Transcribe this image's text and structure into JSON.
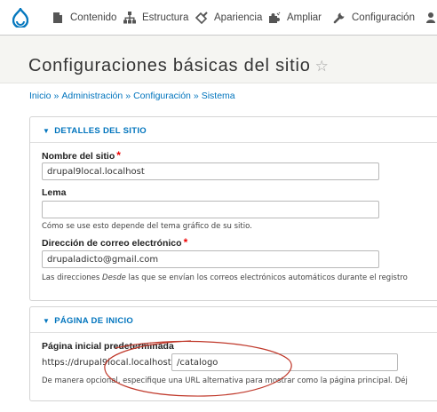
{
  "toolbar": {
    "items": [
      {
        "label": "Contenido",
        "icon": "page-icon"
      },
      {
        "label": "Estructura",
        "icon": "sitemap-icon"
      },
      {
        "label": "Apariencia",
        "icon": "brush-icon"
      },
      {
        "label": "Ampliar",
        "icon": "puzzle-icon"
      },
      {
        "label": "Configuración",
        "icon": "wrench-icon"
      }
    ],
    "brand_color": "#0678be"
  },
  "page": {
    "title": "Configuraciones básicas del sitio",
    "favorite_icon": "☆"
  },
  "breadcrumb": [
    "Inicio",
    "Administración",
    "Configuración",
    "Sistema"
  ],
  "breadcrumb_separator": "»",
  "site_details": {
    "summary": "DETALLES DEL SITIO",
    "site_name": {
      "label": "Nombre del sitio",
      "value": "drupal9local.localhost",
      "required_mark": "*"
    },
    "slogan": {
      "label": "Lema",
      "value": "",
      "description": "Cómo se use esto depende del tema gráfico de su sitio."
    },
    "email": {
      "label": "Dirección de correo electrónico",
      "value": "drupaladicto@gmail.com",
      "required_mark": "*",
      "description_pre": "Las direcciones ",
      "description_em": "Desde",
      "description_post": " las que se envían los correos electrónicos automáticos durante el registro"
    }
  },
  "front_page": {
    "summary": "PÁGINA DE INICIO",
    "label": "Página inicial predeterminada",
    "prefix": "https://drupal9local.localhost",
    "value": "/catalogo",
    "description": "De manera opcional, especifique una URL alternativa para mostrar como la página principal. Déj"
  },
  "colors": {
    "link": "#0074bd",
    "required": "#e00000",
    "annotation": "#c0392b"
  }
}
